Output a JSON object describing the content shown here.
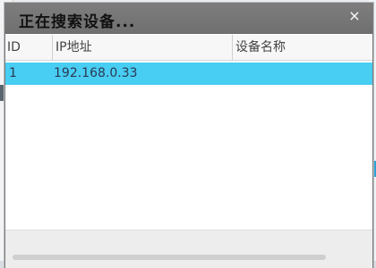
{
  "dialog": {
    "title": "正在搜索设备...",
    "close_icon": "×"
  },
  "table": {
    "columns": [
      "ID",
      "IP地址",
      "设备名称"
    ],
    "rows": [
      {
        "id": "1",
        "ip": "192.168.0.33",
        "name": ""
      }
    ]
  },
  "colors": {
    "titlebar": "#757575",
    "selected_row": "#48cdf3"
  }
}
